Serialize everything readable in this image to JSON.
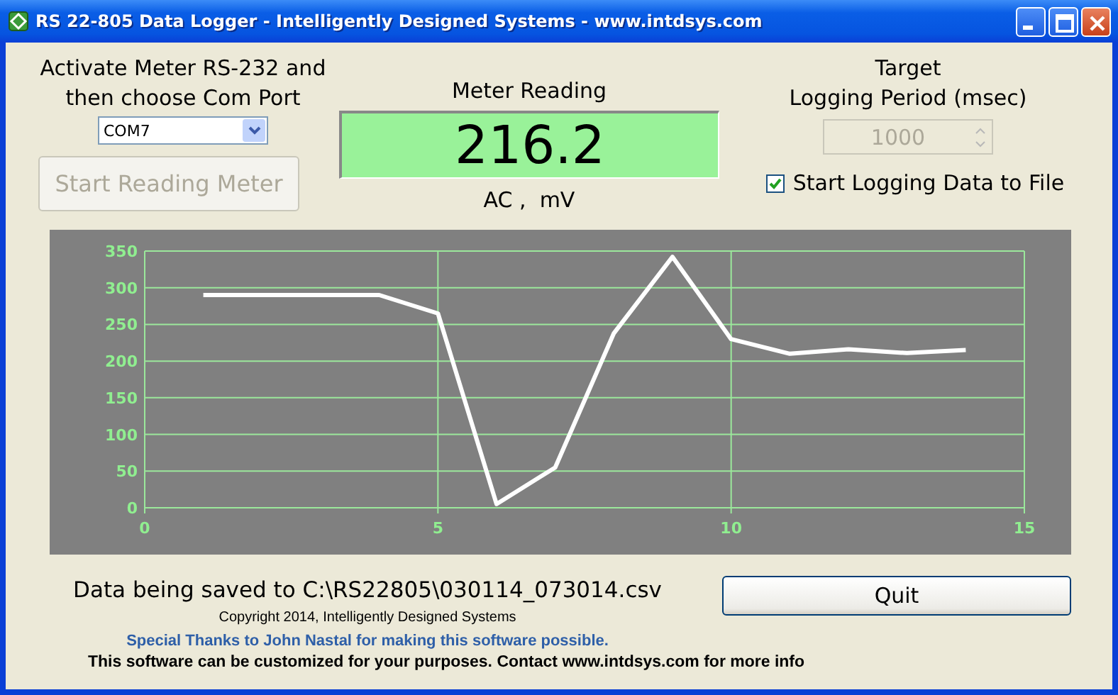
{
  "window": {
    "title": "RS 22-805 Data Logger - Intelligently Designed Systems - www.intdsys.com"
  },
  "port": {
    "label_lines": [
      "Activate Meter RS-232 and",
      "then choose Com Port"
    ],
    "value": "COM7",
    "button": {
      "label": "Start Reading Meter",
      "disabled": true
    }
  },
  "meter": {
    "title": "Meter Reading",
    "reading": "216.2",
    "units": "AC ,  mV"
  },
  "logging": {
    "title_lines": [
      "Target",
      "Logging Period (msec)"
    ],
    "period": {
      "value": "1000",
      "disabled": true
    },
    "checkbox": {
      "label": "Start Logging Data to File",
      "checked": true
    }
  },
  "chart_data": {
    "type": "line",
    "x": [
      1,
      2,
      3,
      4,
      5,
      6,
      7,
      8,
      9,
      10,
      11,
      12,
      13,
      14
    ],
    "series": [
      {
        "color": "#ffffff",
        "values": [
          290,
          290,
          290,
          290,
          265,
          5,
          55,
          238,
          342,
          230,
          210,
          216,
          211,
          215
        ]
      }
    ],
    "xlim": [
      0,
      15
    ],
    "ylim": [
      0,
      350
    ],
    "xticks": [
      0,
      5,
      10,
      15
    ],
    "yticks": [
      0,
      50,
      100,
      150,
      200,
      250,
      300,
      350
    ],
    "grid": true
  },
  "footer": {
    "save_status": "Data being saved to C:\\RS22805\\030114_073014.csv",
    "copyright": "Copyright 2014, Intelligently Designed Systems",
    "thanks": "Special Thanks to John Nastal for making this software possible.",
    "info": "This software can be customized for your purposes.  Contact www.intdsys.com for more info",
    "quit": "Quit"
  }
}
